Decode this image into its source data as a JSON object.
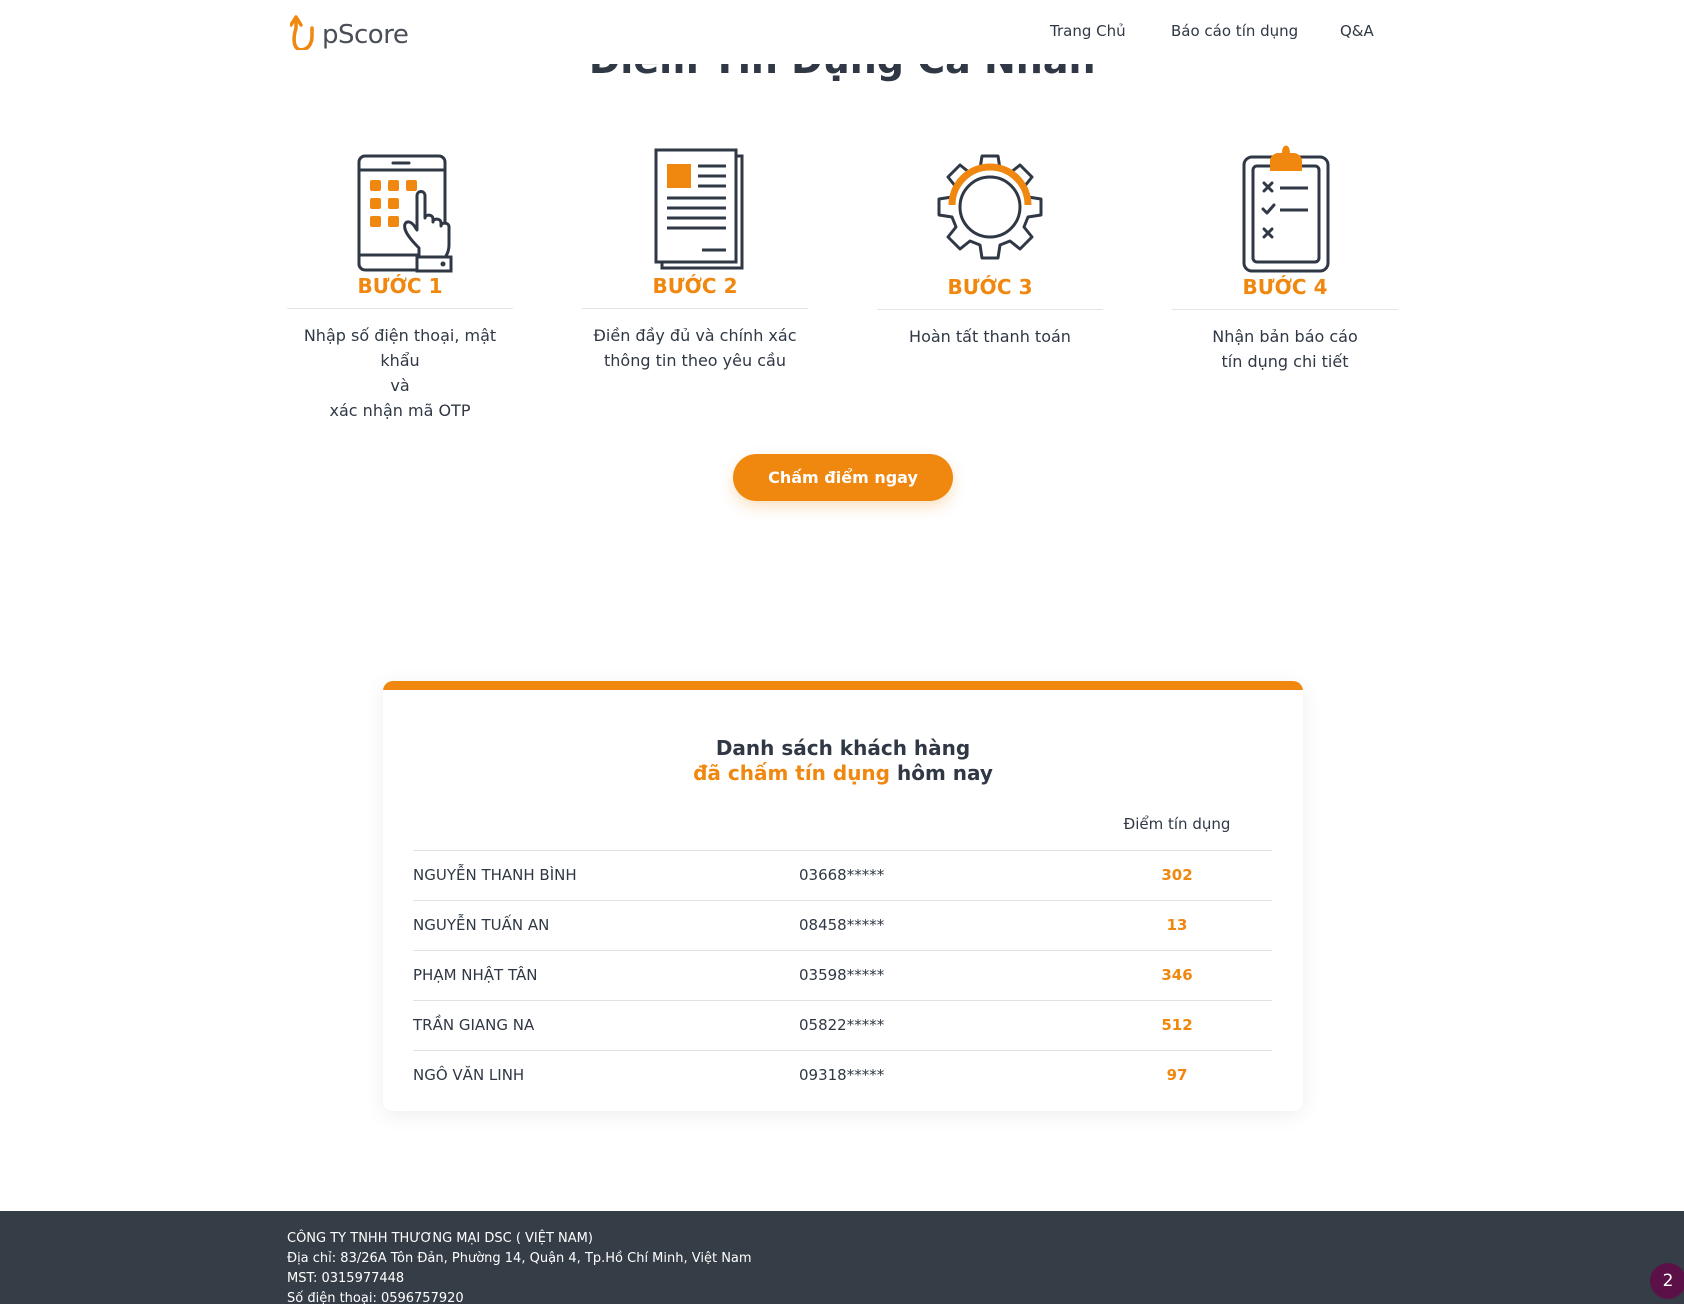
{
  "header": {
    "logo_text": "pScore",
    "nav": [
      "Trang Chủ",
      "Báo cáo tín dụng",
      "Q&A"
    ]
  },
  "section": {
    "title": "Điểm Tín Dụng Cá Nhân"
  },
  "steps": [
    {
      "title": "BƯỚC 1",
      "lines": [
        "Nhập số điện thoại, mật khẩu",
        "và",
        "xác nhận mã OTP"
      ],
      "icon": "tablet-touch-icon"
    },
    {
      "title": "BƯỚC 2",
      "lines": [
        "Điền đầy đủ và chính xác",
        "thông tin theo yêu cầu"
      ],
      "icon": "document-icon"
    },
    {
      "title": "BƯỚC 3",
      "lines": [
        "Hoàn tất thanh toán"
      ],
      "icon": "gear-icon"
    },
    {
      "title": "BƯỚC 4",
      "lines": [
        "Nhận bản báo cáo",
        "tín dụng chi tiết"
      ],
      "icon": "clipboard-checklist-icon"
    }
  ],
  "cta_label": "Chấm điểm ngay",
  "customers": {
    "title_line1": "Danh sách khách hàng",
    "title_highlight": "đã chấm tín dụng",
    "title_rest": " hôm nay",
    "score_header": "Điểm tín dụng",
    "rows": [
      {
        "name": "NGUYỄN THANH BÌNH",
        "phone": "03668*****",
        "score": "302"
      },
      {
        "name": "NGUYỄN TUẤN AN",
        "phone": "08458*****",
        "score": "13"
      },
      {
        "name": "PHẠM NHẬT TÂN",
        "phone": "03598*****",
        "score": "346"
      },
      {
        "name": "TRẦN GIANG NA",
        "phone": "05822*****",
        "score": "512"
      },
      {
        "name": "NGÔ VĂN LINH",
        "phone": "09318*****",
        "score": "97"
      }
    ]
  },
  "footer": {
    "company": "CÔNG TY TNHH THƯƠNG MẠI DSC ( VIỆT NAM)",
    "address": "Địa chỉ: 83/26A Tôn Đản, Phường 14, Quận 4, Tp.Hồ Chí Minh, Việt Nam",
    "tax": "MST: 0315977448",
    "phone": "Số điện thoại: 0596757920"
  },
  "chat_badge": "2",
  "colors": {
    "accent": "#f0870f",
    "text": "#2f3844",
    "footer_bg": "#353d47",
    "badge": "#5b1147"
  }
}
